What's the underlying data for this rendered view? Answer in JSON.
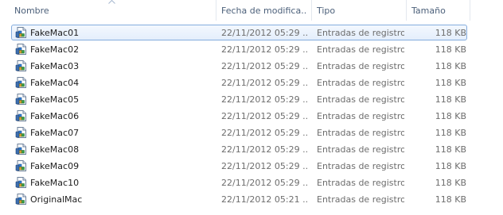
{
  "columns": {
    "name": "Nombre",
    "date": "Fecha de modifica...",
    "type": "Tipo",
    "size": "Tamaño"
  },
  "sort": {
    "column": "name",
    "direction": "ascending",
    "indicator_icon": "sort-up-arrow-icon"
  },
  "files": [
    {
      "name": "FakeMac01",
      "date": "22/11/2012 05:29 ...",
      "type": "Entradas de registro",
      "size": "118 KB",
      "icon": "registry-file-icon",
      "selected": true
    },
    {
      "name": "FakeMac02",
      "date": "22/11/2012 05:29 ...",
      "type": "Entradas de registro",
      "size": "118 KB",
      "icon": "registry-file-icon",
      "selected": false
    },
    {
      "name": "FakeMac03",
      "date": "22/11/2012 05:29 ...",
      "type": "Entradas de registro",
      "size": "118 KB",
      "icon": "registry-file-icon",
      "selected": false
    },
    {
      "name": "FakeMac04",
      "date": "22/11/2012 05:29 ...",
      "type": "Entradas de registro",
      "size": "118 KB",
      "icon": "registry-file-icon",
      "selected": false
    },
    {
      "name": "FakeMac05",
      "date": "22/11/2012 05:29 ...",
      "type": "Entradas de registro",
      "size": "118 KB",
      "icon": "registry-file-icon",
      "selected": false
    },
    {
      "name": "FakeMac06",
      "date": "22/11/2012 05:29 ...",
      "type": "Entradas de registro",
      "size": "118 KB",
      "icon": "registry-file-icon",
      "selected": false
    },
    {
      "name": "FakeMac07",
      "date": "22/11/2012 05:29 ...",
      "type": "Entradas de registro",
      "size": "118 KB",
      "icon": "registry-file-icon",
      "selected": false
    },
    {
      "name": "FakeMac08",
      "date": "22/11/2012 05:29 ...",
      "type": "Entradas de registro",
      "size": "118 KB",
      "icon": "registry-file-icon",
      "selected": false
    },
    {
      "name": "FakeMac09",
      "date": "22/11/2012 05:29 ...",
      "type": "Entradas de registro",
      "size": "118 KB",
      "icon": "registry-file-icon",
      "selected": false
    },
    {
      "name": "FakeMac10",
      "date": "22/11/2012 05:29 ...",
      "type": "Entradas de registro",
      "size": "118 KB",
      "icon": "registry-file-icon",
      "selected": false
    },
    {
      "name": "OriginalMac",
      "date": "22/11/2012 05:21 ...",
      "type": "Entradas de registro",
      "size": "118 KB",
      "icon": "registry-file-icon",
      "selected": false
    }
  ],
  "colors": {
    "header_text": "#4c607a",
    "selection_border": "#84acdd",
    "selection_fill": "#e4eefc",
    "secondary_text": "#6d6d6d"
  }
}
